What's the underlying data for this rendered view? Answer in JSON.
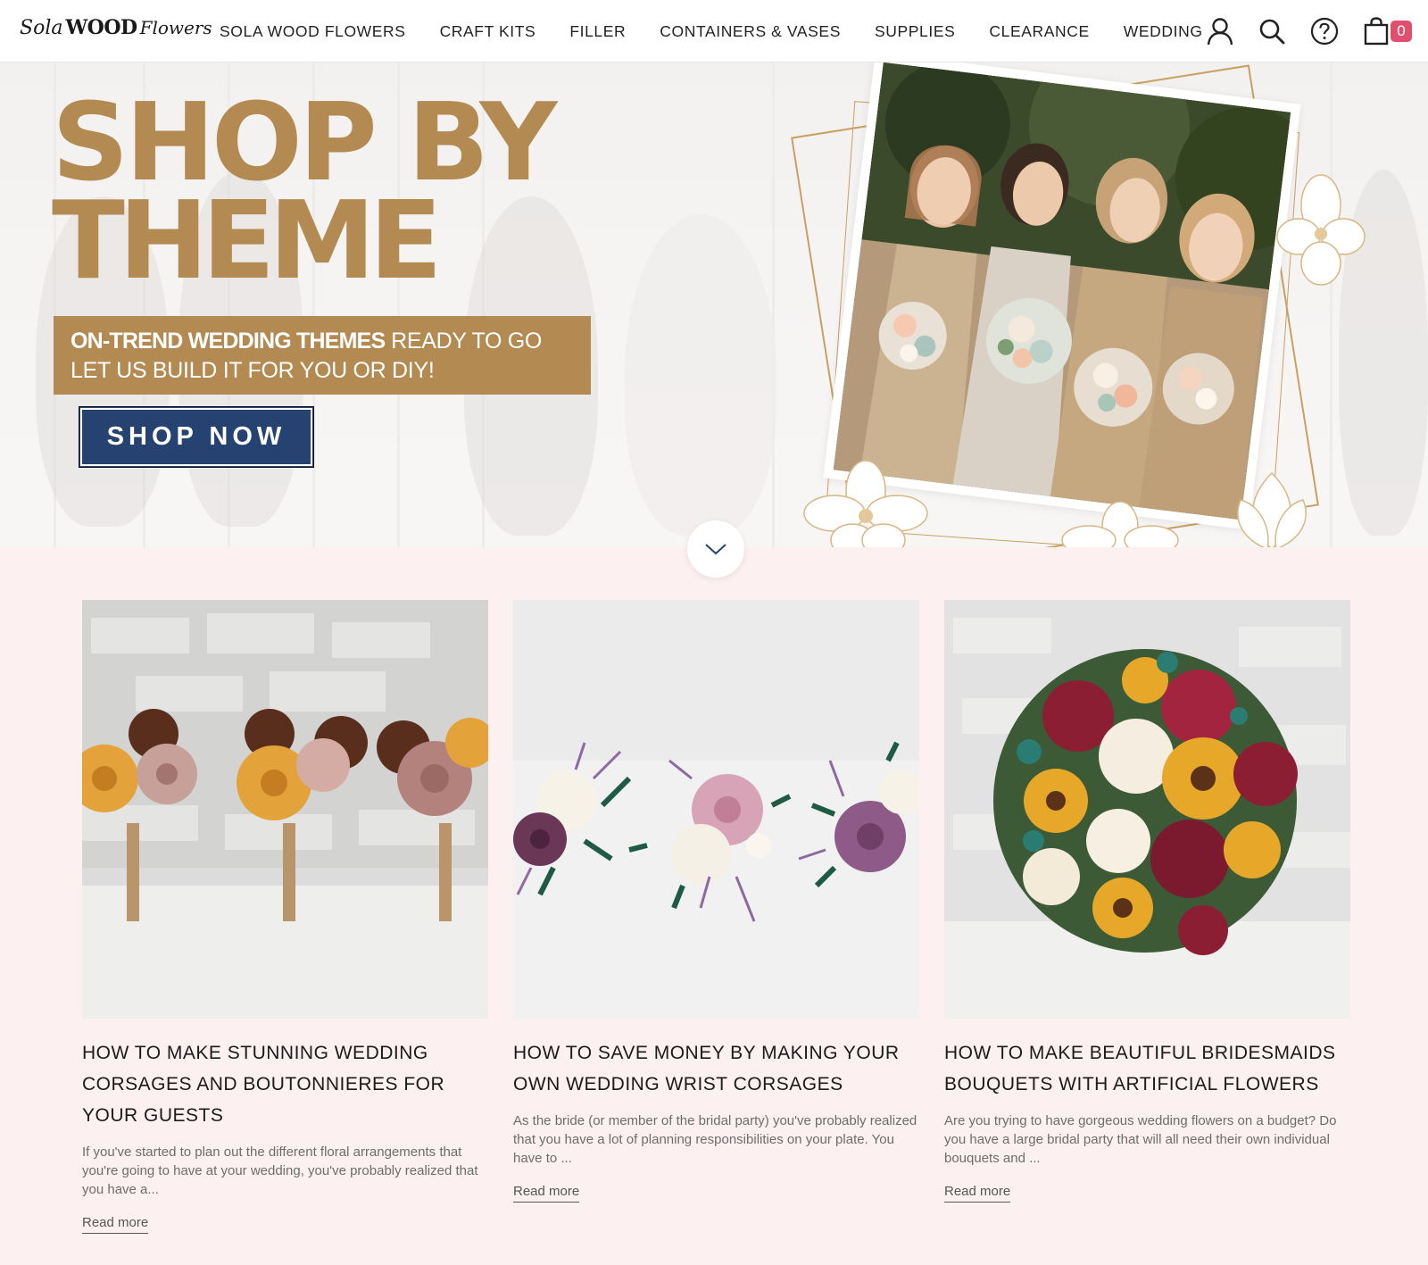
{
  "header": {
    "logo": {
      "part1": "Sola",
      "part2": "WOOD",
      "part3": "Flowers"
    },
    "nav": [
      {
        "label": "SOLA WOOD FLOWERS"
      },
      {
        "label": "CRAFT KITS"
      },
      {
        "label": "FILLER"
      },
      {
        "label": "CONTAINERS & VASES"
      },
      {
        "label": "SUPPLIES"
      },
      {
        "label": "CLEARANCE"
      },
      {
        "label": "WEDDING"
      }
    ],
    "icons": [
      "account-icon",
      "search-icon",
      "help-icon",
      "cart-icon"
    ],
    "cart_count": "0"
  },
  "hero": {
    "title_line1": "SHOP BY",
    "title_line2": "THEME",
    "band_bold": "ON-TREND WEDDING THEMES",
    "band_rest": " READY TO GO",
    "band_line2": "LET US BUILD IT FOR YOU OR DIY!",
    "cta": "SHOP NOW",
    "colors": {
      "gold": "#b38a52",
      "navy": "#264270"
    }
  },
  "articles": [
    {
      "title": "HOW TO MAKE STUNNING WEDDING CORSAGES AND BOUTONNIERES FOR YOUR GUESTS",
      "excerpt": "If you've started to plan out the different floral arrangements that you're going to have at your wedding, you've probably realized that you have a...",
      "link": "Read more"
    },
    {
      "title": "HOW TO SAVE MONEY BY MAKING YOUR OWN WEDDING WRIST CORSAGES",
      "excerpt": "As the bride (or member of the bridal party) you've probably realized that you have a lot of planning responsibilities on your plate.  You have to ...",
      "link": "Read more"
    },
    {
      "title": "HOW TO MAKE BEAUTIFUL BRIDESMAIDS BOUQUETS WITH ARTIFICIAL FLOWERS",
      "excerpt": "Are you trying to have gorgeous wedding flowers on a budget? Do you have a large bridal party that will all need their own individual bouquets and ...",
      "link": "Read more"
    }
  ]
}
